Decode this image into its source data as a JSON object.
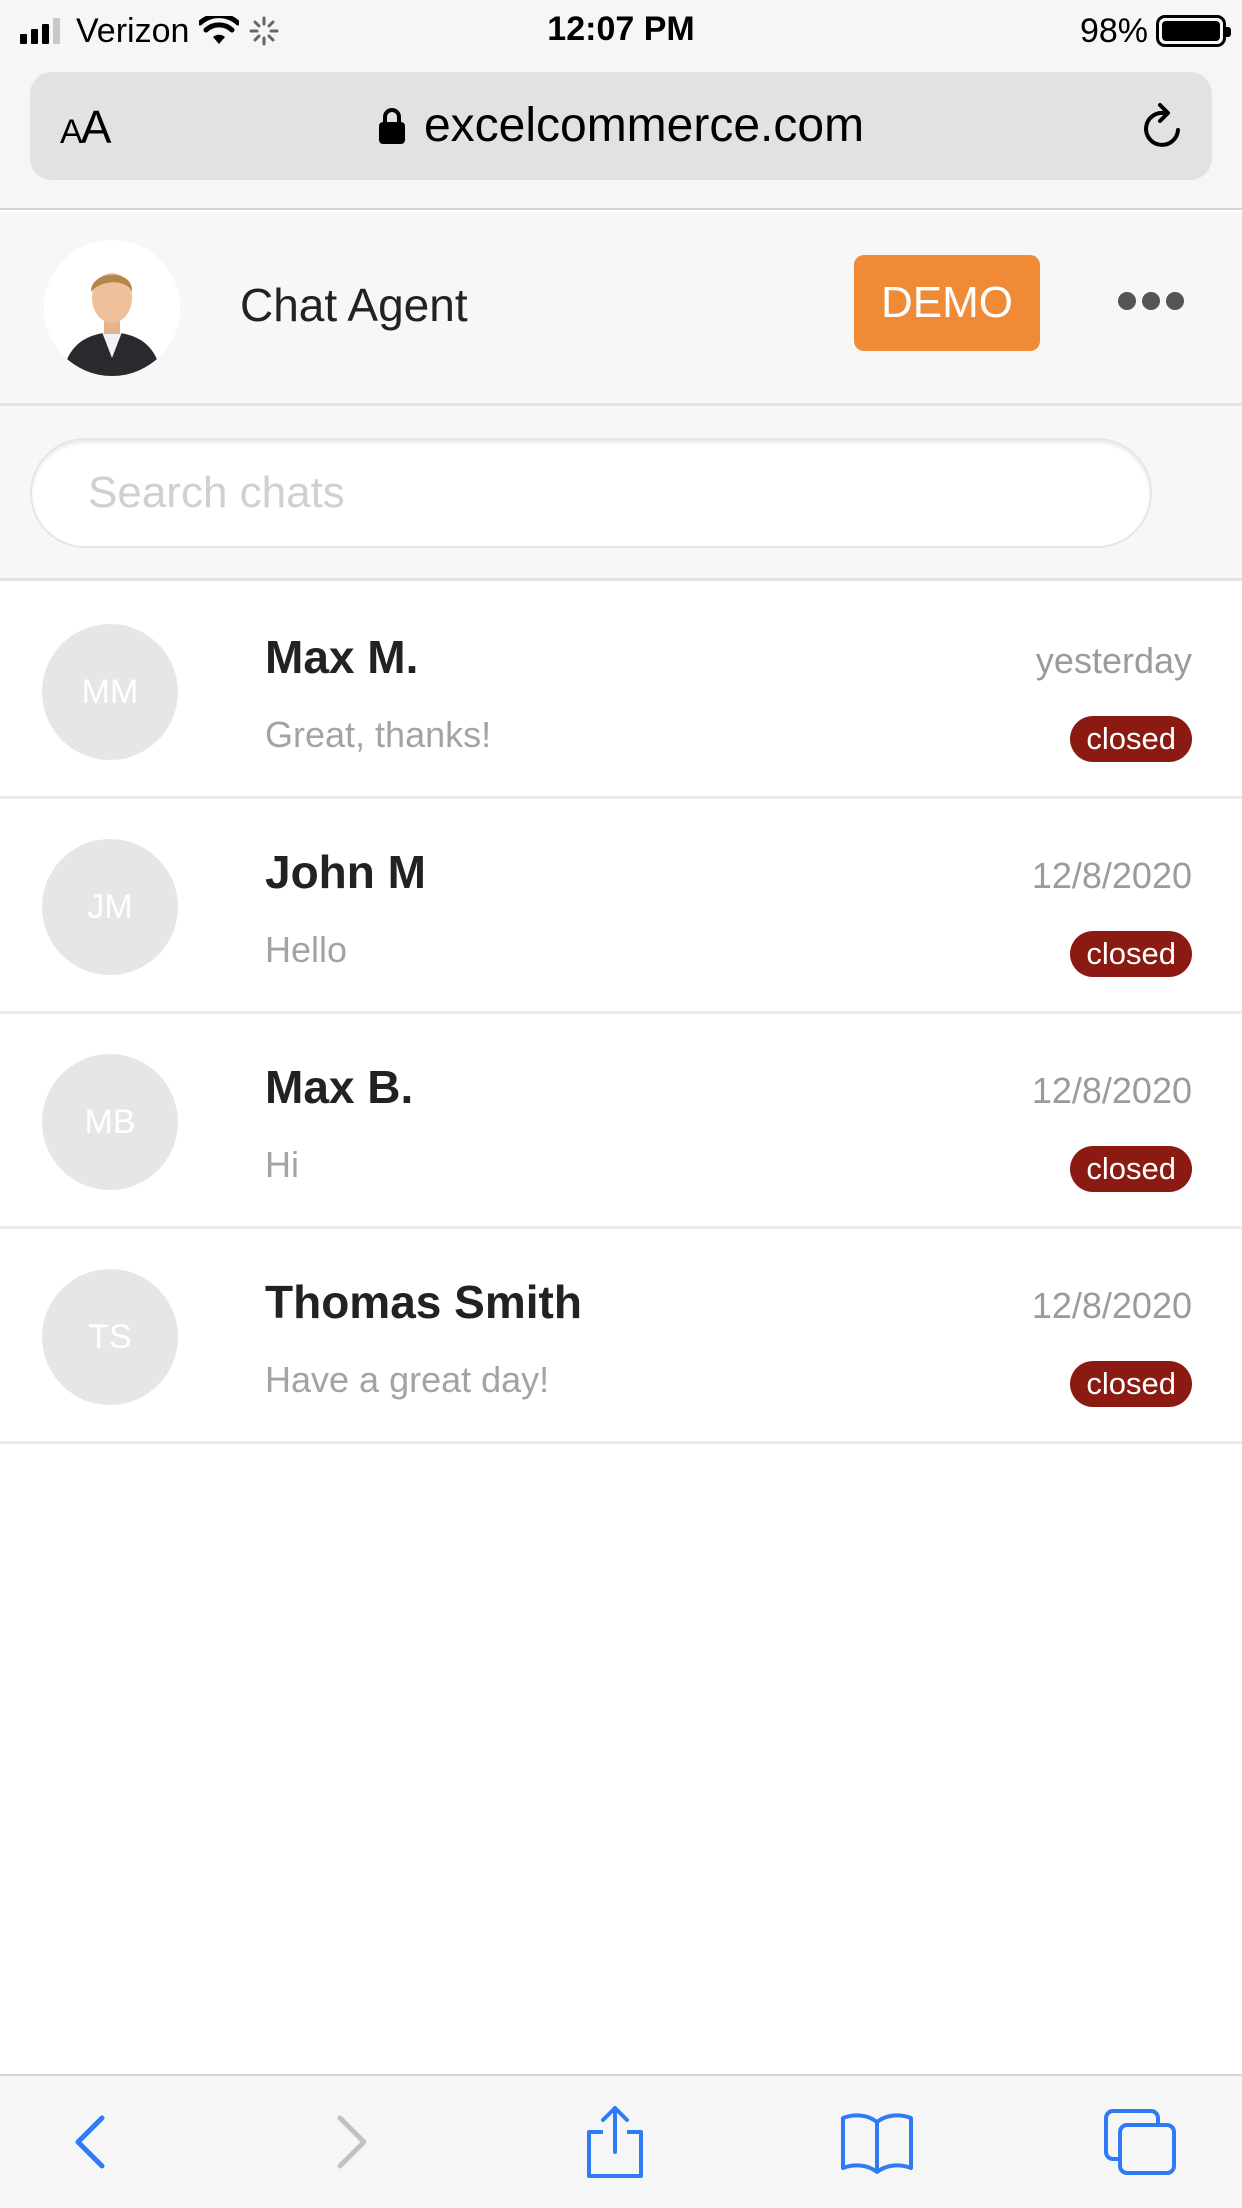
{
  "status_bar": {
    "carrier": "Verizon",
    "time": "12:07 PM",
    "battery": "98%"
  },
  "browser": {
    "text_size_label": "AA",
    "url": "excelcommerce.com"
  },
  "header": {
    "agent_name": "Chat Agent",
    "demo_label": "DEMO"
  },
  "search": {
    "placeholder": "Search chats",
    "value": ""
  },
  "chats": [
    {
      "initials": "MM",
      "name": "Max M.",
      "date": "yesterday",
      "preview": "Great, thanks!",
      "status": "closed"
    },
    {
      "initials": "JM",
      "name": "John M",
      "date": "12/8/2020",
      "preview": "Hello",
      "status": "closed"
    },
    {
      "initials": "MB",
      "name": "Max B.",
      "date": "12/8/2020",
      "preview": "Hi",
      "status": "closed"
    },
    {
      "initials": "TS",
      "name": "Thomas Smith",
      "date": "12/8/2020",
      "preview": "Have a great day!",
      "status": "closed"
    }
  ],
  "colors": {
    "accent": "#f08a36",
    "status_closed": "#8b1a12",
    "ios_blue": "#2f7bf5"
  },
  "icons": {
    "toolbar": [
      "back-icon",
      "forward-icon",
      "share-icon",
      "bookmarks-icon",
      "tabs-icon"
    ],
    "header": [
      "agent-avatar",
      "more-icon"
    ],
    "browser": [
      "lock-icon",
      "reload-icon"
    ]
  }
}
